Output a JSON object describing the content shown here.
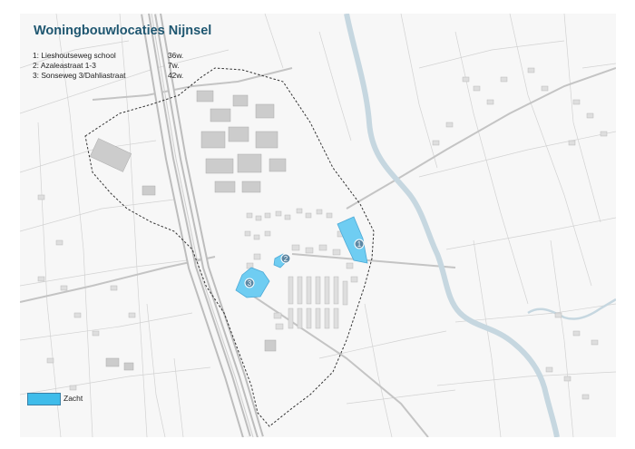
{
  "map": {
    "title": "Woningbouwlocaties Nijnsel",
    "locations": [
      {
        "number": "1:",
        "name": "Lieshoutseweg school",
        "count": "36w."
      },
      {
        "number": "2:",
        "name": "Azaleastraat 1-3",
        "count": "7w."
      },
      {
        "number": "3:",
        "name": "Sonseweg 3/Dahliastraat",
        "count": "42w."
      }
    ],
    "markers": [
      "1",
      "2",
      "3"
    ],
    "legend": {
      "label": "Zacht"
    },
    "colors": {
      "highlight_fill": "#6fcdf2",
      "legend_fill": "#3fbcea",
      "marker_fill": "#5c87a3",
      "river": "#c6d7e0",
      "title": "#1e5670"
    }
  }
}
